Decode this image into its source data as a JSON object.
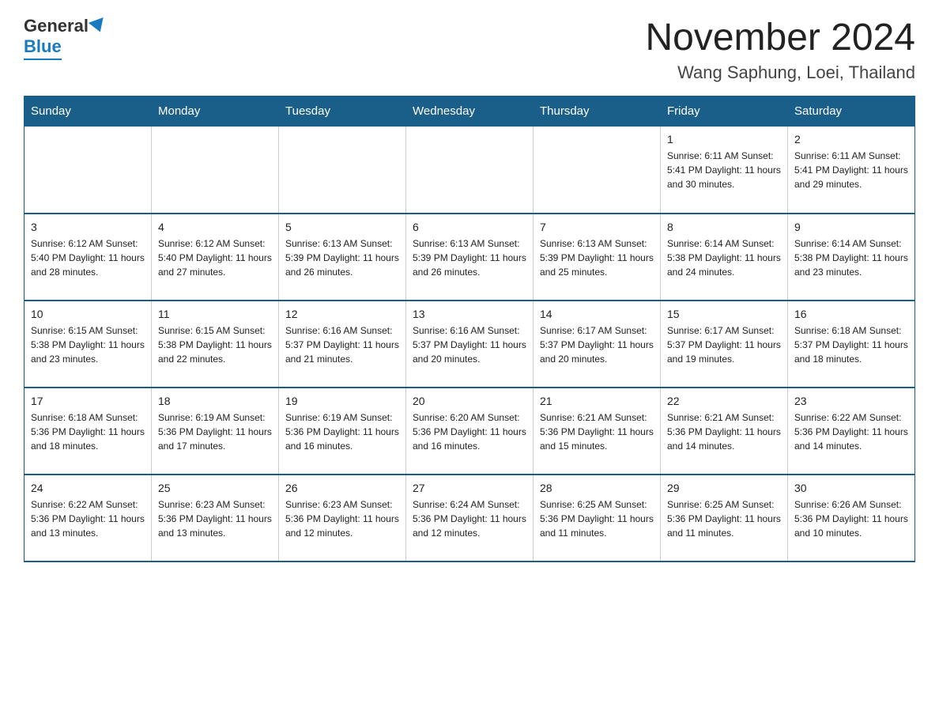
{
  "header": {
    "logo_general": "General",
    "logo_blue": "Blue",
    "month_title": "November 2024",
    "location": "Wang Saphung, Loei, Thailand"
  },
  "days_of_week": [
    "Sunday",
    "Monday",
    "Tuesday",
    "Wednesday",
    "Thursday",
    "Friday",
    "Saturday"
  ],
  "weeks": [
    {
      "days": [
        {
          "num": "",
          "info": ""
        },
        {
          "num": "",
          "info": ""
        },
        {
          "num": "",
          "info": ""
        },
        {
          "num": "",
          "info": ""
        },
        {
          "num": "",
          "info": ""
        },
        {
          "num": "1",
          "info": "Sunrise: 6:11 AM\nSunset: 5:41 PM\nDaylight: 11 hours\nand 30 minutes."
        },
        {
          "num": "2",
          "info": "Sunrise: 6:11 AM\nSunset: 5:41 PM\nDaylight: 11 hours\nand 29 minutes."
        }
      ]
    },
    {
      "days": [
        {
          "num": "3",
          "info": "Sunrise: 6:12 AM\nSunset: 5:40 PM\nDaylight: 11 hours\nand 28 minutes."
        },
        {
          "num": "4",
          "info": "Sunrise: 6:12 AM\nSunset: 5:40 PM\nDaylight: 11 hours\nand 27 minutes."
        },
        {
          "num": "5",
          "info": "Sunrise: 6:13 AM\nSunset: 5:39 PM\nDaylight: 11 hours\nand 26 minutes."
        },
        {
          "num": "6",
          "info": "Sunrise: 6:13 AM\nSunset: 5:39 PM\nDaylight: 11 hours\nand 26 minutes."
        },
        {
          "num": "7",
          "info": "Sunrise: 6:13 AM\nSunset: 5:39 PM\nDaylight: 11 hours\nand 25 minutes."
        },
        {
          "num": "8",
          "info": "Sunrise: 6:14 AM\nSunset: 5:38 PM\nDaylight: 11 hours\nand 24 minutes."
        },
        {
          "num": "9",
          "info": "Sunrise: 6:14 AM\nSunset: 5:38 PM\nDaylight: 11 hours\nand 23 minutes."
        }
      ]
    },
    {
      "days": [
        {
          "num": "10",
          "info": "Sunrise: 6:15 AM\nSunset: 5:38 PM\nDaylight: 11 hours\nand 23 minutes."
        },
        {
          "num": "11",
          "info": "Sunrise: 6:15 AM\nSunset: 5:38 PM\nDaylight: 11 hours\nand 22 minutes."
        },
        {
          "num": "12",
          "info": "Sunrise: 6:16 AM\nSunset: 5:37 PM\nDaylight: 11 hours\nand 21 minutes."
        },
        {
          "num": "13",
          "info": "Sunrise: 6:16 AM\nSunset: 5:37 PM\nDaylight: 11 hours\nand 20 minutes."
        },
        {
          "num": "14",
          "info": "Sunrise: 6:17 AM\nSunset: 5:37 PM\nDaylight: 11 hours\nand 20 minutes."
        },
        {
          "num": "15",
          "info": "Sunrise: 6:17 AM\nSunset: 5:37 PM\nDaylight: 11 hours\nand 19 minutes."
        },
        {
          "num": "16",
          "info": "Sunrise: 6:18 AM\nSunset: 5:37 PM\nDaylight: 11 hours\nand 18 minutes."
        }
      ]
    },
    {
      "days": [
        {
          "num": "17",
          "info": "Sunrise: 6:18 AM\nSunset: 5:36 PM\nDaylight: 11 hours\nand 18 minutes."
        },
        {
          "num": "18",
          "info": "Sunrise: 6:19 AM\nSunset: 5:36 PM\nDaylight: 11 hours\nand 17 minutes."
        },
        {
          "num": "19",
          "info": "Sunrise: 6:19 AM\nSunset: 5:36 PM\nDaylight: 11 hours\nand 16 minutes."
        },
        {
          "num": "20",
          "info": "Sunrise: 6:20 AM\nSunset: 5:36 PM\nDaylight: 11 hours\nand 16 minutes."
        },
        {
          "num": "21",
          "info": "Sunrise: 6:21 AM\nSunset: 5:36 PM\nDaylight: 11 hours\nand 15 minutes."
        },
        {
          "num": "22",
          "info": "Sunrise: 6:21 AM\nSunset: 5:36 PM\nDaylight: 11 hours\nand 14 minutes."
        },
        {
          "num": "23",
          "info": "Sunrise: 6:22 AM\nSunset: 5:36 PM\nDaylight: 11 hours\nand 14 minutes."
        }
      ]
    },
    {
      "days": [
        {
          "num": "24",
          "info": "Sunrise: 6:22 AM\nSunset: 5:36 PM\nDaylight: 11 hours\nand 13 minutes."
        },
        {
          "num": "25",
          "info": "Sunrise: 6:23 AM\nSunset: 5:36 PM\nDaylight: 11 hours\nand 13 minutes."
        },
        {
          "num": "26",
          "info": "Sunrise: 6:23 AM\nSunset: 5:36 PM\nDaylight: 11 hours\nand 12 minutes."
        },
        {
          "num": "27",
          "info": "Sunrise: 6:24 AM\nSunset: 5:36 PM\nDaylight: 11 hours\nand 12 minutes."
        },
        {
          "num": "28",
          "info": "Sunrise: 6:25 AM\nSunset: 5:36 PM\nDaylight: 11 hours\nand 11 minutes."
        },
        {
          "num": "29",
          "info": "Sunrise: 6:25 AM\nSunset: 5:36 PM\nDaylight: 11 hours\nand 11 minutes."
        },
        {
          "num": "30",
          "info": "Sunrise: 6:26 AM\nSunset: 5:36 PM\nDaylight: 11 hours\nand 10 minutes."
        }
      ]
    }
  ]
}
